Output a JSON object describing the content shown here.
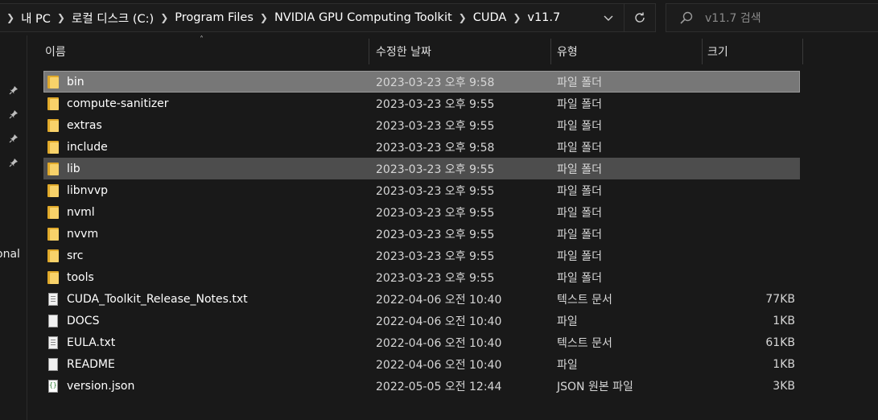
{
  "address": {
    "breadcrumbs": [
      "내 PC",
      "로컬 디스크 (C:)",
      "Program Files",
      "NVIDIA GPU Computing Toolkit",
      "CUDA",
      "v11.7"
    ]
  },
  "search": {
    "placeholder": "v11.7 검색"
  },
  "nav": {
    "partial_label": "onal"
  },
  "columns": {
    "name": "이름",
    "date": "수정한 날짜",
    "type": "유형",
    "size": "크기"
  },
  "files": [
    {
      "name": "bin",
      "date": "2023-03-23 오후 9:58",
      "type": "파일 폴더",
      "size": "",
      "icon": "folder-icon",
      "state": "selected"
    },
    {
      "name": "compute-sanitizer",
      "date": "2023-03-23 오후 9:55",
      "type": "파일 폴더",
      "size": "",
      "icon": "folder-icon",
      "state": ""
    },
    {
      "name": "extras",
      "date": "2023-03-23 오후 9:55",
      "type": "파일 폴더",
      "size": "",
      "icon": "folder-icon",
      "state": ""
    },
    {
      "name": "include",
      "date": "2023-03-23 오후 9:58",
      "type": "파일 폴더",
      "size": "",
      "icon": "folder-icon",
      "state": ""
    },
    {
      "name": "lib",
      "date": "2023-03-23 오후 9:55",
      "type": "파일 폴더",
      "size": "",
      "icon": "folder-icon",
      "state": "hover"
    },
    {
      "name": "libnvvp",
      "date": "2023-03-23 오후 9:55",
      "type": "파일 폴더",
      "size": "",
      "icon": "folder-icon",
      "state": ""
    },
    {
      "name": "nvml",
      "date": "2023-03-23 오후 9:55",
      "type": "파일 폴더",
      "size": "",
      "icon": "folder-icon",
      "state": ""
    },
    {
      "name": "nvvm",
      "date": "2023-03-23 오후 9:55",
      "type": "파일 폴더",
      "size": "",
      "icon": "folder-icon",
      "state": ""
    },
    {
      "name": "src",
      "date": "2023-03-23 오후 9:55",
      "type": "파일 폴더",
      "size": "",
      "icon": "folder-icon",
      "state": ""
    },
    {
      "name": "tools",
      "date": "2023-03-23 오후 9:55",
      "type": "파일 폴더",
      "size": "",
      "icon": "folder-icon",
      "state": ""
    },
    {
      "name": "CUDA_Toolkit_Release_Notes.txt",
      "date": "2022-04-06 오전 10:40",
      "type": "텍스트 문서",
      "size": "77KB",
      "icon": "text-file-icon",
      "state": ""
    },
    {
      "name": "DOCS",
      "date": "2022-04-06 오전 10:40",
      "type": "파일",
      "size": "1KB",
      "icon": "file-icon",
      "state": ""
    },
    {
      "name": "EULA.txt",
      "date": "2022-04-06 오전 10:40",
      "type": "텍스트 문서",
      "size": "61KB",
      "icon": "text-file-icon",
      "state": ""
    },
    {
      "name": "README",
      "date": "2022-04-06 오전 10:40",
      "type": "파일",
      "size": "1KB",
      "icon": "file-icon",
      "state": ""
    },
    {
      "name": "version.json",
      "date": "2022-05-05 오전 12:44",
      "type": "JSON 원본 파일",
      "size": "3KB",
      "icon": "json-file-icon",
      "state": ""
    }
  ],
  "colors": {
    "background": "#191919",
    "selected_row": "#777777",
    "hover_row": "#4d4d4d",
    "folder": "#f8d26a"
  }
}
